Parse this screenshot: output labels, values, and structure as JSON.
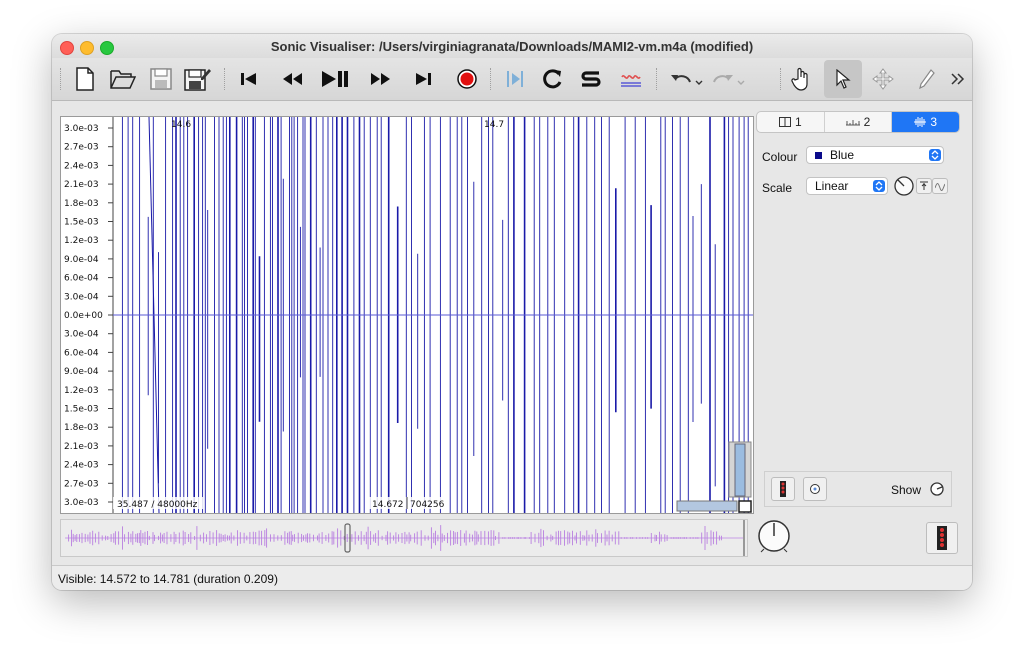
{
  "window": {
    "title": "Sonic Visualiser: /Users/virginiagranata/Downloads/MAMI2-vm.m4a (modified)"
  },
  "toolbar": {
    "icons": [
      "new-file-icon",
      "open-folder-icon",
      "save-icon",
      "save-as-icon",
      "rewind-start-icon",
      "rewind-icon",
      "play-pause-icon",
      "fast-forward-icon",
      "ffwd-end-icon",
      "record-icon",
      "play-selection-icon",
      "loop-icon",
      "solo-icon",
      "align-icon",
      "undo-icon",
      "redo-icon",
      "navigate-hand-icon",
      "select-arrow-icon",
      "move-icon",
      "draw-pencil-icon",
      "more-chevron-icon"
    ]
  },
  "waveform": {
    "y_ticks": [
      "3.0e-03",
      "2.7e-03",
      "2.4e-03",
      "2.1e-03",
      "1.8e-03",
      "1.5e-03",
      "1.2e-03",
      "9.0e-04",
      "6.0e-04",
      "3.0e-04",
      "0.0e+00",
      "3.0e-04",
      "6.0e-04",
      "9.0e-04",
      "1.2e-03",
      "1.5e-03",
      "1.8e-03",
      "2.1e-03",
      "2.4e-03",
      "2.7e-03",
      "3.0e-03"
    ],
    "time_marks": [
      "14.6",
      "14.7"
    ],
    "bottom_left_info": "35.487 / 48000Hz",
    "bottom_cursor_time": "14.672",
    "bottom_cursor_frame": "704256",
    "colors": {
      "wave": "#1a1aa8",
      "axis": "#5a5ad6"
    }
  },
  "properties": {
    "tabs": [
      {
        "icon": "pane-icon",
        "label": "1"
      },
      {
        "icon": "ruler-icon",
        "label": "2"
      },
      {
        "icon": "waveform-icon",
        "label": "3"
      }
    ],
    "colour_label": "Colour",
    "colour_value": "Blue",
    "scale_label": "Scale",
    "scale_value": "Linear",
    "show_label": "Show"
  },
  "status": {
    "text": "Visible: 14.572 to 14.781 (duration 0.209)"
  },
  "accent": "#1f76f5"
}
